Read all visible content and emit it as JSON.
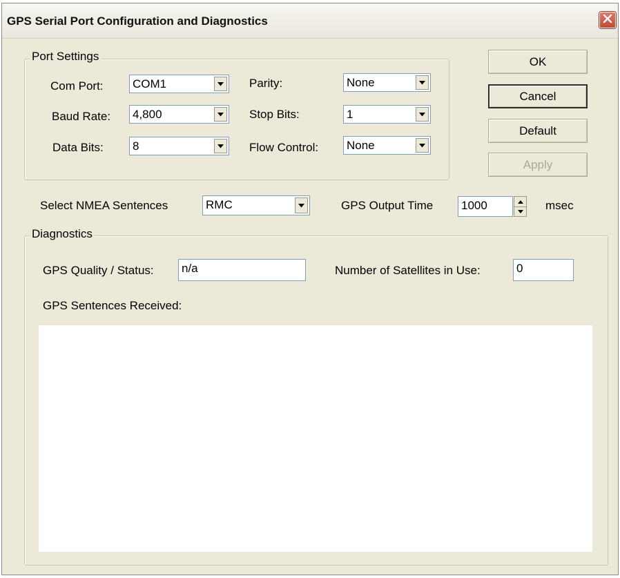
{
  "window": {
    "title": "GPS Serial Port Configuration and Diagnostics"
  },
  "icons": {
    "close": "close-icon",
    "dropdown": "chevron-down-icon",
    "spin_up": "spin-up-icon",
    "spin_down": "spin-down-icon"
  },
  "port_settings": {
    "legend": "Port Settings",
    "com_port": {
      "label": "Com Port:",
      "value": "COM1"
    },
    "baud_rate": {
      "label": "Baud Rate:",
      "value": "4,800"
    },
    "data_bits": {
      "label": "Data Bits:",
      "value": "8"
    },
    "parity": {
      "label": "Parity:",
      "value": "None"
    },
    "stop_bits": {
      "label": "Stop Bits:",
      "value": "1"
    },
    "flow_control": {
      "label": "Flow Control:",
      "value": "None"
    }
  },
  "buttons": {
    "ok": "OK",
    "cancel": "Cancel",
    "default": "Default",
    "apply": "Apply"
  },
  "nmea": {
    "label": "Select NMEA Sentences",
    "value": "RMC"
  },
  "output_time": {
    "label": "GPS Output Time",
    "value": "1000",
    "unit": "msec"
  },
  "diagnostics": {
    "legend": "Diagnostics",
    "quality_label": "GPS Quality / Status:",
    "quality_value": "n/a",
    "satellites_label": "Number of Satellites in Use:",
    "satellites_value": "0",
    "sentences_label": "GPS Sentences Received:",
    "sentences_value": ""
  }
}
